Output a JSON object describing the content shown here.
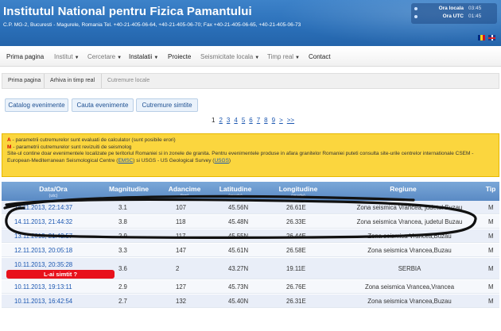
{
  "header": {
    "title": "Institutul National pentru Fizica Pamantului",
    "address": "C.P. MG-2, Bucuresti - Magurele, Romania Tel. +40-21-405-06-64, +40-21-405-06-70; Fax +40-21-405-06-65, +40-21-405-06-73",
    "clock": {
      "local_label": "Ora locala",
      "local_value": "03:45",
      "utc_label": "Ora UTC",
      "utc_value": "01:45"
    },
    "flags": [
      "romania-flag-icon",
      "uk-flag-icon"
    ]
  },
  "nav": {
    "items": [
      {
        "label": "Prima pagina",
        "dropdown": false,
        "dim": false
      },
      {
        "label": "Institut",
        "dropdown": true,
        "dim": true
      },
      {
        "label": "Cercetare",
        "dropdown": true,
        "dim": true
      },
      {
        "label": "Instalatii",
        "dropdown": true,
        "dim": false
      },
      {
        "label": "Proiecte",
        "dropdown": false,
        "dim": false
      },
      {
        "label": "Seismicitate locala",
        "dropdown": true,
        "dim": true
      },
      {
        "label": "Timp real",
        "dropdown": true,
        "dim": true
      },
      {
        "label": "Contact",
        "dropdown": false,
        "dim": false
      }
    ]
  },
  "breadcrumb": {
    "items": [
      "Prima pagina",
      "Arhiva in timp real",
      "Cutremure locale"
    ]
  },
  "buttons": {
    "catalog": "Catalog evenimente",
    "search": "Cauta evenimente",
    "felt": "Cutremure simtite"
  },
  "pager": {
    "pages": [
      "1",
      "2",
      "3",
      "4",
      "5",
      "6",
      "7",
      "8",
      "9",
      ">",
      ">>"
    ],
    "current": "1"
  },
  "info": {
    "line1_tag": "A",
    "line1": " - parametrii cutremurelor sunt evaluati de calculator (sunt posibile erori)",
    "line2_tag": "M",
    "line2": " - parametrii cutremurelor sunt revizuiti de seismolog",
    "line3": "Site-ul contine doar evenimentele localizate pe teritoriul Romaniei si in zonele de granita. Pentru evenimentele produse in afara granitelor Romaniei puteti consulta site-urile centrelor internationale CSEM -",
    "line4a": "European-Mediterranean Seismological Centre (",
    "line4_emsc": "EMSC",
    "line4b": ") si USGS - US Geological Survey (",
    "line4_usgs": "USGS",
    "line4c": ")"
  },
  "table": {
    "headers": {
      "date": "Data/Ora",
      "date_sub": "(utc)",
      "mag": "Magnitudine",
      "depth": "Adancime",
      "depth_sub": "(km)",
      "lat": "Latitudine",
      "lat_sub": "(grade)",
      "lon": "Longitudine",
      "lon_sub": "(grade)",
      "region": "Regiune",
      "type": "Tip"
    },
    "rows": [
      {
        "date": "14.11.2013, 22:14:37",
        "mag": "3.1",
        "depth": "107",
        "lat": "45.56N",
        "lon": "26.61E",
        "region": "Zona seismica Vrancea, judetul Buzau",
        "type": "M"
      },
      {
        "date": "14.11.2013, 21:44:32",
        "mag": "3.8",
        "depth": "118",
        "lat": "45.48N",
        "lon": "26.33E",
        "region": "Zona seismica Vrancea, judetul Buzau",
        "type": "M"
      },
      {
        "date": "13.11.2013, 21:42:57",
        "mag": "2.9",
        "depth": "117",
        "lat": "45.55N",
        "lon": "26.44E",
        "region": "Zona seismica Vrancea,Buzau",
        "type": "M"
      },
      {
        "date": "12.11.2013, 20:05:18",
        "mag": "3.3",
        "depth": "147",
        "lat": "45.61N",
        "lon": "26.58E",
        "region": "Zona seismica Vrancea,Buzau",
        "type": "M"
      },
      {
        "date": "10.11.2013, 20:35:28",
        "mag": "3.6",
        "depth": "2",
        "lat": "43.27N",
        "lon": "19.11E",
        "region": "SERBIA",
        "type": "M",
        "felt": "L-ai simtit ?"
      },
      {
        "date": "10.11.2013, 19:13:11",
        "mag": "2.9",
        "depth": "127",
        "lat": "45.73N",
        "lon": "26.76E",
        "region": "Zona seismica Vrancea,Vrancea",
        "type": "M"
      },
      {
        "date": "10.11.2013, 16:42:54",
        "mag": "2.7",
        "depth": "132",
        "lat": "45.40N",
        "lon": "26.31E",
        "region": "Zona seismica Vrancea,Buzau",
        "type": "M"
      }
    ]
  },
  "colors": {
    "header_blue": "#2a6fb8",
    "table_header": "#5a8ac4",
    "info_yellow": "#fbd63e",
    "felt_red": "#e8111b",
    "link_blue": "#1a56b0"
  }
}
